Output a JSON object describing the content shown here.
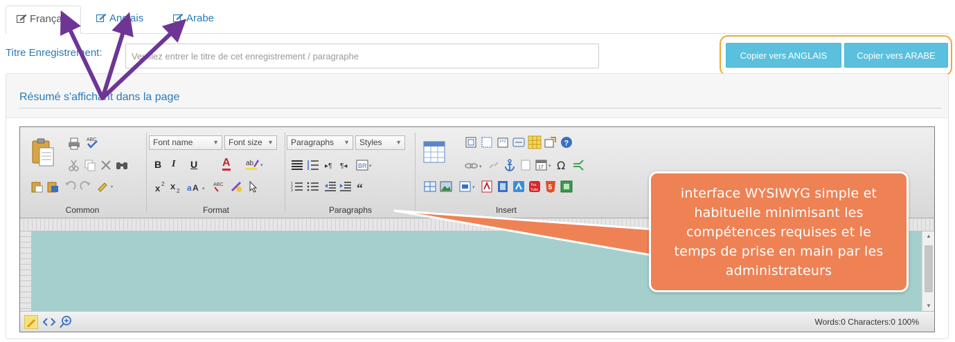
{
  "tabs": [
    {
      "label": "Français",
      "icon": "edit-icon",
      "active": true
    },
    {
      "label": "Anglais",
      "icon": "edit-icon",
      "active": false
    },
    {
      "label": "Arabe",
      "icon": "edit-icon",
      "active": false
    }
  ],
  "record_title": {
    "label": "Titre Enregistrement:",
    "placeholder": "Veuillez entrer le titre de cet enregistrement / paragraphe",
    "value": ""
  },
  "copy_buttons": {
    "english": "Copier vers ANGLAIS",
    "arabic": "Copier vers ARABE"
  },
  "panel": {
    "title": "Résumé s'affichant dans la page"
  },
  "editor": {
    "font_name": "Font name",
    "font_size": "Font size",
    "paragraphs_select": "Paragraphs",
    "styles_select": "Styles",
    "groups": {
      "common": "Common",
      "format": "Format",
      "paragraphs": "Paragraphs",
      "insert": "Insert"
    },
    "format_letters": {
      "bold": "B",
      "italic": "I",
      "underline": "U",
      "font_color": "A"
    },
    "status": "Words:0 Characters:0  100%"
  },
  "callout": {
    "lines": [
      "interface WYSIWYG simple et",
      "habituelle minimisant les",
      "compétences requises et le",
      "temps de prise en main par les",
      "administrateurs"
    ]
  },
  "colors": {
    "link_blue": "#2a7ab8",
    "button_info": "#5bc0de",
    "highlight_border": "#eba93a",
    "callout_fill": "#ee8255",
    "arrow_purple": "#6e3596",
    "editor_content": "#a5cfcc"
  }
}
